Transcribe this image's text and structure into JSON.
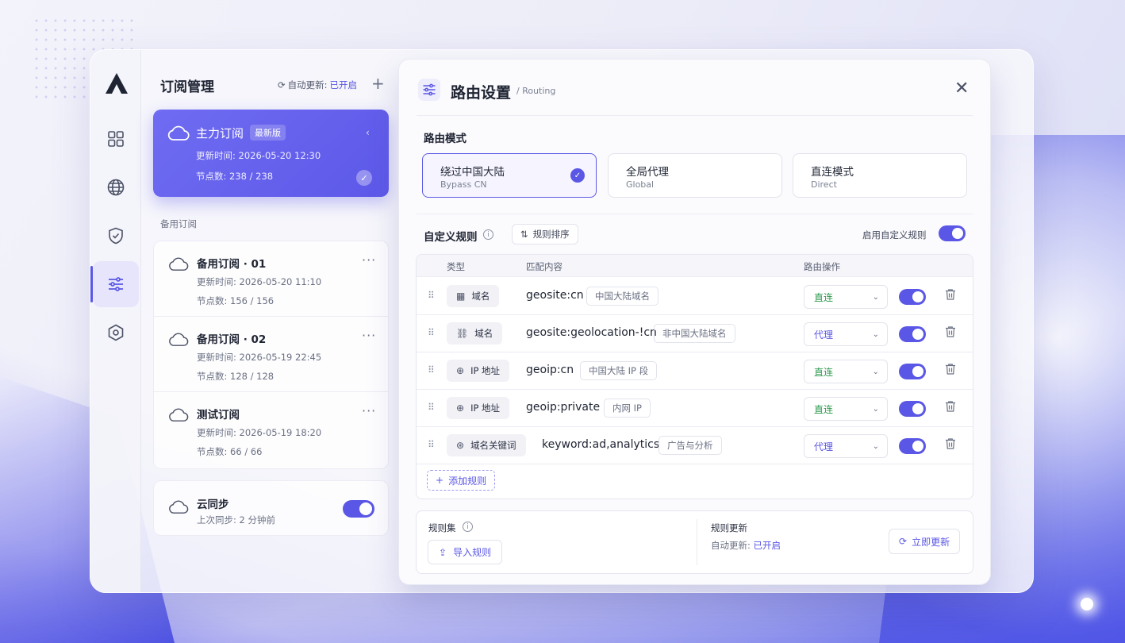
{
  "colors": {
    "accent": "#5b57e6",
    "direct": "#2f9a50",
    "background": "#ececf8"
  },
  "sidebar": {
    "logo": "logo-icon",
    "items": [
      {
        "icon": "grid-icon",
        "active": false
      },
      {
        "icon": "globe-icon",
        "active": false
      },
      {
        "icon": "shield-icon",
        "active": false
      },
      {
        "icon": "sliders-icon",
        "active": true
      },
      {
        "icon": "hexagon-settings-icon",
        "active": false
      }
    ]
  },
  "subscriptions": {
    "title": "订阅管理",
    "auto_update_label": "自动更新:",
    "auto_update_value": "已开启",
    "add_icon": "plus-icon",
    "main": {
      "name": "主力订阅",
      "badge": "最新版",
      "updated_label": "更新时间:",
      "updated_value": "2026-05-20 12:30",
      "nodes_label": "节点数:",
      "nodes_value": "238 / 238",
      "selected": true
    },
    "backup_label": "备用订阅",
    "items": [
      {
        "name": "备用订阅 · 01",
        "updated_label": "更新时间:",
        "updated_value": "2026-05-20 11:10",
        "nodes_label": "节点数:",
        "nodes_value": "156 / 156"
      },
      {
        "name": "备用订阅 · 02",
        "updated_label": "更新时间:",
        "updated_value": "2026-05-19 22:45",
        "nodes_label": "节点数:",
        "nodes_value": "128 / 128"
      },
      {
        "name": "测试订阅",
        "updated_label": "更新时间:",
        "updated_value": "2026-05-19 18:20",
        "nodes_label": "节点数:",
        "nodes_value": "66 / 66"
      }
    ],
    "cloud_sync": {
      "name": "云同步",
      "last_label": "上次同步:",
      "last_value": "2 分钟前",
      "enabled": true
    }
  },
  "routing": {
    "title": "路由设置",
    "subtitle": "/ Routing",
    "mode_label": "路由模式",
    "modes": [
      {
        "name": "绕过中国大陆",
        "sub": "Bypass CN",
        "selected": true
      },
      {
        "name": "全局代理",
        "sub": "Global",
        "selected": false
      },
      {
        "name": "直连模式",
        "sub": "Direct",
        "selected": false
      }
    ],
    "custom_rules_label": "自定义规则",
    "sort_label": "规则排序",
    "enable_label": "启用自定义规则",
    "enable_custom": true,
    "table": {
      "col_type": "类型",
      "col_match": "匹配内容",
      "col_action": "路由操作",
      "rows": [
        {
          "type_icon": "domain-icon",
          "type": "域名",
          "match": "geosite:cn",
          "tag": "中国大陆域名",
          "action": "直连",
          "action_kind": "direct",
          "enabled": true
        },
        {
          "type_icon": "link-icon",
          "type": "域名",
          "match": "geosite:geolocation-!cn",
          "tag": "非中国大陆域名",
          "action": "代理",
          "action_kind": "proxy",
          "enabled": true
        },
        {
          "type_icon": "ip-icon",
          "type": "IP 地址",
          "match": "geoip:cn",
          "tag": "中国大陆 IP 段",
          "action": "直连",
          "action_kind": "direct",
          "enabled": true
        },
        {
          "type_icon": "ip-icon",
          "type": "IP 地址",
          "match": "geoip:private",
          "tag": "内网 IP",
          "action": "直连",
          "action_kind": "direct",
          "enabled": true
        },
        {
          "type_icon": "keyword-icon",
          "type": "域名关键词",
          "match": "keyword:ad,analytics",
          "tag": "广告与分析",
          "action": "代理",
          "action_kind": "proxy",
          "enabled": true
        }
      ]
    },
    "add_rule_label": "添加规则",
    "ruleset_label": "规则集",
    "import_label": "导入规则",
    "rule_update_label": "规则更新",
    "rule_auto_label": "自动更新:",
    "rule_auto_value": "已开启",
    "update_now_label": "立即更新"
  }
}
